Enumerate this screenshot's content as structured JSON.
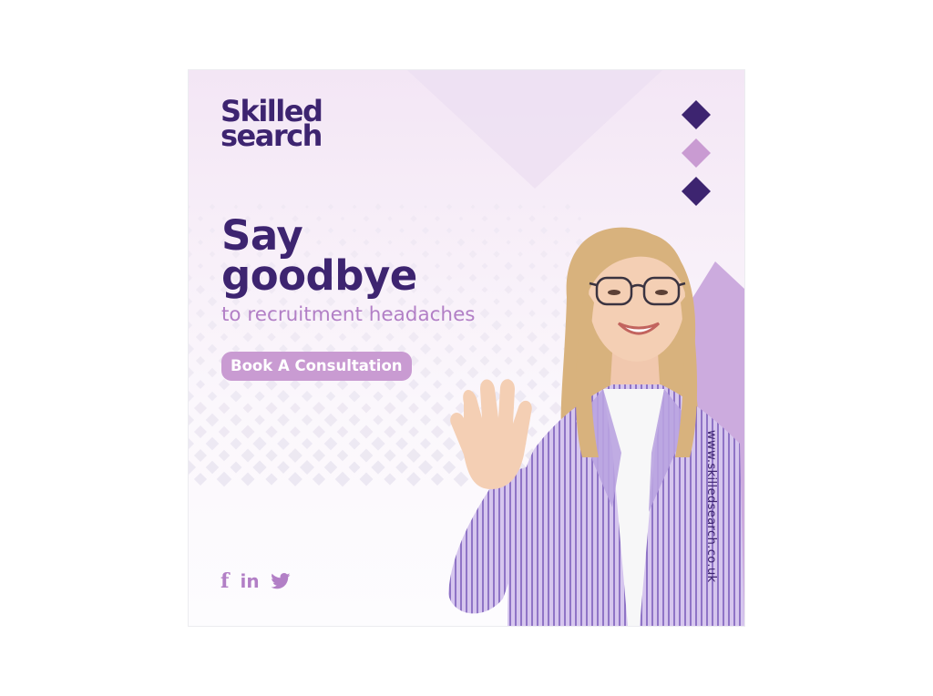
{
  "brand": {
    "line1": "Skilled",
    "line2": "search"
  },
  "headline": {
    "line1": "Say",
    "line2": "goodbye"
  },
  "subheadline": "to recruitment headaches",
  "cta_label": "Book A Consultation",
  "website": "www.skilledsearch.co.uk",
  "socials": {
    "facebook": "f",
    "linkedin": "in",
    "twitter": "twitter-icon"
  },
  "colors": {
    "brand_dark": "#3d2470",
    "brand_light": "#c99bd2",
    "accent_text": "#b27fc6",
    "lavender": "#c9a6dc"
  }
}
